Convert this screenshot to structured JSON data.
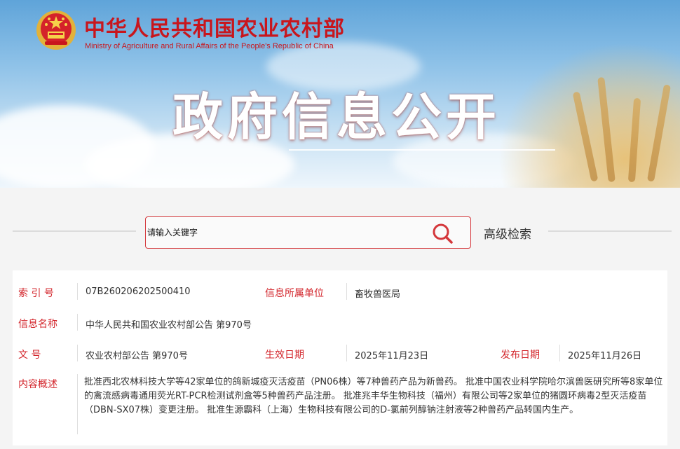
{
  "header": {
    "ministry_cn": "中华人民共和国农业农村部",
    "ministry_en": "Ministry of Agriculture and Rural Affairs of the People's Republic of China",
    "banner_title": "政府信息公开",
    "brand_color": "#c8161d"
  },
  "search": {
    "placeholder": "请输入关键字",
    "button_icon": "search-icon",
    "advanced_label": "高级检索"
  },
  "info": {
    "index_label": "索 引 号",
    "index_value": "07B260206202500410",
    "unit_label": "信息所属单位",
    "unit_value": "畜牧兽医局",
    "name_label": "信息名称",
    "name_value": "中华人民共和国农业农村部公告 第970号",
    "doc_label": "文 号",
    "doc_value": "农业农村部公告 第970号",
    "effective_label": "生效日期",
    "effective_value": "2025年11月23日",
    "publish_label": "发布日期",
    "publish_value": "2025年11月26日",
    "summary_label": "内容概述",
    "summary_value": "批准西北农林科技大学等42家单位的鸽新城疫灭活疫苗（PN06株）等7种兽药产品为新兽药。 批准中国农业科学院哈尔滨兽医研究所等8家单位的禽流感病毒通用荧光RT-PCR检测试剂盒等5种兽药产品注册。 批准兆丰华生物科技（福州）有限公司等2家单位的猪圆环病毒2型灭活疫苗（DBN-SX07株）变更注册。 批准生源霸科（上海）生物科技有限公司的D-氯前列醇钠注射液等2种兽药产品转国内生产。"
  }
}
